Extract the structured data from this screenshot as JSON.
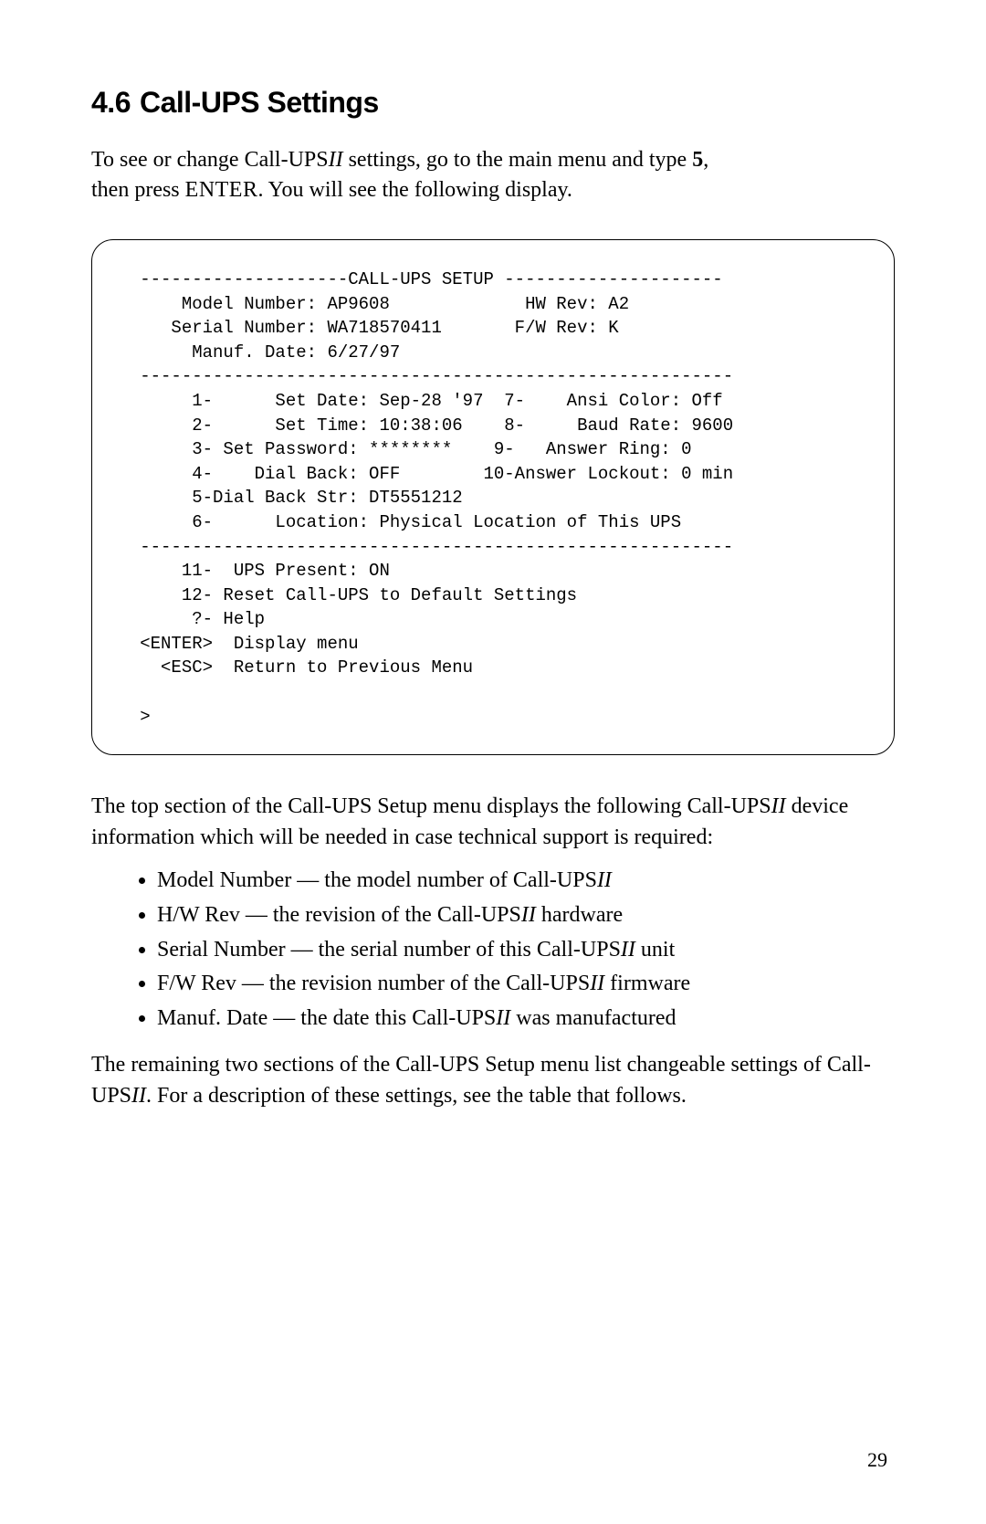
{
  "heading": {
    "number": "4.6",
    "title": "Call-UPS Settings"
  },
  "intro": {
    "pre": "To see or change Call-UPS",
    "it0": "II",
    "mid": " settings, go to the main menu and type ",
    "key": "5",
    "line2a": "then press ",
    "enter": "ENTER",
    "line2b": ". You will see the following display."
  },
  "terminal": {
    "t01": "   --------------------CALL-UPS SETUP ---------------------",
    "t02": "       Model Number: AP9608             HW Rev: A2",
    "t03": "      Serial Number: WA718570411       F/W Rev: K",
    "t04": "        Manuf. Date: 6/27/97",
    "t05": "   ---------------------------------------------------------",
    "t06": "        1-      Set Date: Sep-28 '97  7-    Ansi Color: Off",
    "t07": "        2-      Set Time: 10:38:06    8-     Baud Rate: 9600",
    "t08": "        3- Set Password: ********    9-   Answer Ring: 0",
    "t09": "        4-    Dial Back: OFF        10-Answer Lockout: 0 min",
    "t10": "        5-Dial Back Str: DT5551212",
    "t11": "        6-      Location: Physical Location of This UPS",
    "t12": "   ---------------------------------------------------------",
    "t13": "       11-  UPS Present: ON",
    "t14": "       12- Reset Call-UPS to Default Settings",
    "t15": "        ?- Help",
    "t16": "   <ENTER>  Display menu",
    "t17": "     <ESC>  Return to Previous Menu",
    "t18": "",
    "t19": "   >"
  },
  "p2": {
    "a": "The top section of the Call-UPS Setup menu displays the following Call-UPS",
    "it": "II",
    "b": " device information which will be needed in case technical support is required:"
  },
  "bullets": {
    "b1a": "Model Number — the model number of Call-UPS",
    "b1it": "II",
    "b2a": "H/W Rev — the revision of the Call-UPS",
    "b2it": "II",
    "b2b": " hardware",
    "b3a": "Serial Number — the serial number of this Call-UPS",
    "b3it": "II",
    "b3b": " unit",
    "b4a": "F/W Rev — the revision number of the Call-UPS",
    "b4it": "II",
    "b4b": " firmware",
    "b5a": "Manuf. Date — the date this Call-UPS",
    "b5it": "II",
    "b5b": " was manufactured"
  },
  "p3": {
    "a": "The remaining two sections of the Call-UPS Setup menu list changeable settings of Call-UPS",
    "it": "II",
    "b": ". For a description of these settings, see the table that follows."
  },
  "page": "29"
}
